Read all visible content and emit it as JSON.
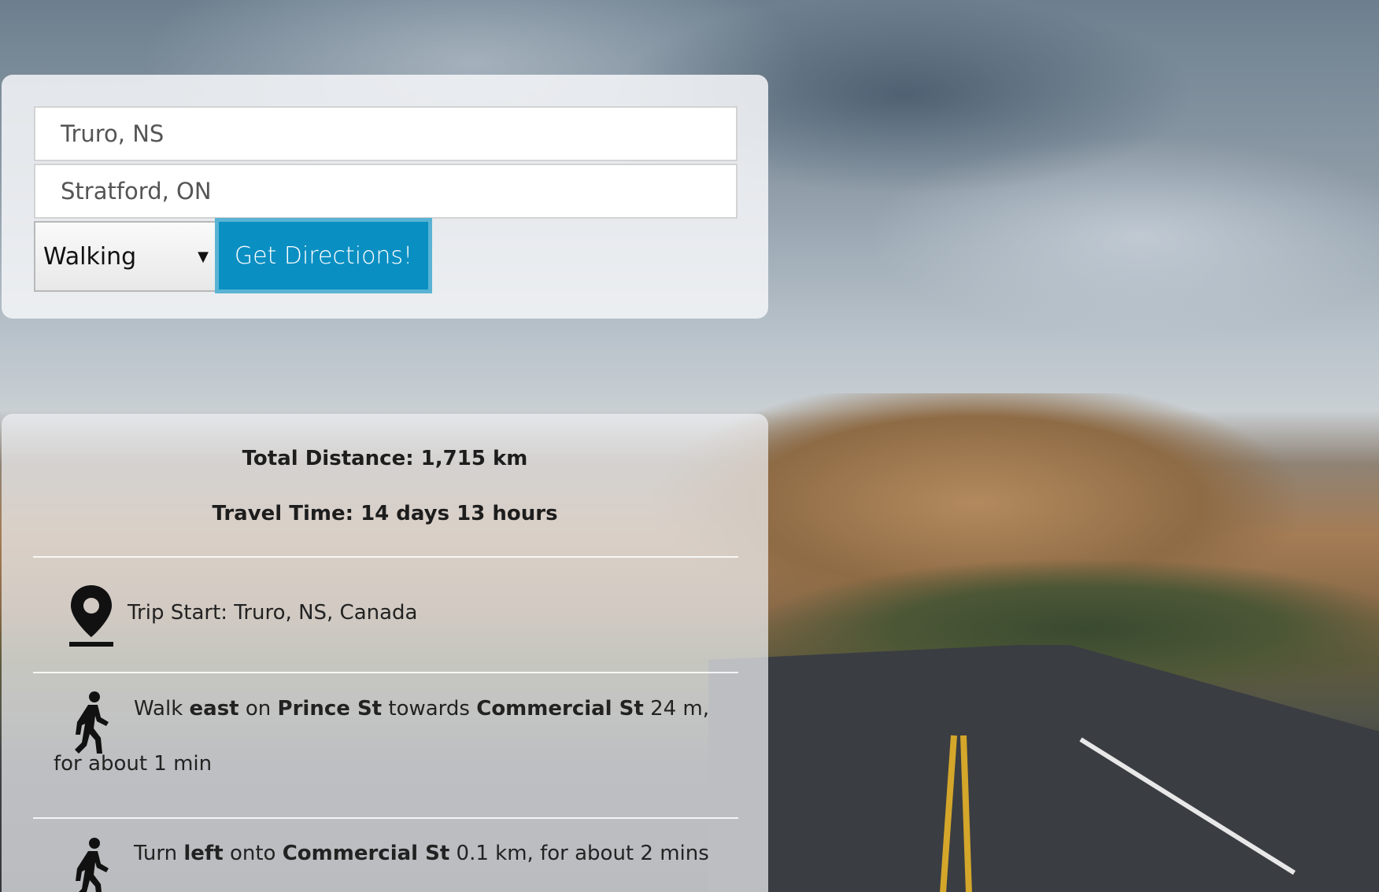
{
  "search": {
    "origin_value": "Truro, NS",
    "destination_value": "Stratford, ON",
    "mode_selected": "Walking",
    "button_label": "Get Directions!"
  },
  "summary": {
    "total_distance": "Total Distance: 1,715 km",
    "travel_time": "Travel Time: 14 days 13 hours"
  },
  "steps": [
    {
      "icon": "map-pin-icon",
      "text": "Trip Start: Truro, NS, Canada"
    },
    {
      "icon": "walking-person-icon",
      "parts": [
        "Walk ",
        "east",
        " on ",
        "Prince St",
        " towards ",
        "Commercial St",
        " 24 m, for about 1 min"
      ]
    },
    {
      "icon": "walking-person-icon",
      "parts": [
        "Turn ",
        "left",
        " onto ",
        "Commercial St",
        " 0.1 km, for about 2 mins"
      ]
    }
  ]
}
